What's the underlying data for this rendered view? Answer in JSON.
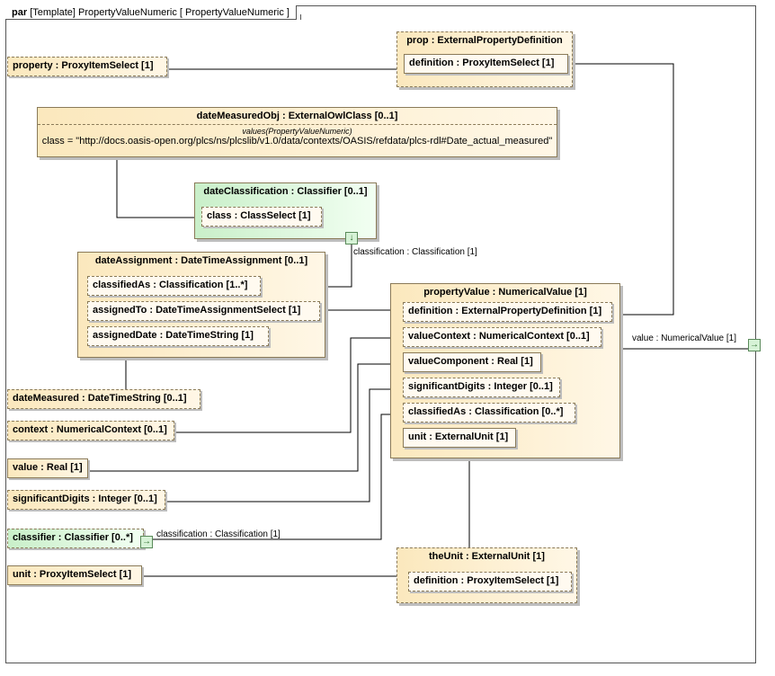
{
  "frame": {
    "kind": "par",
    "label": "[Template] PropertyValueNumeric [ PropertyValueNumeric ]"
  },
  "nodes": {
    "property": "property : ProxyItemSelect [1]",
    "prop_title": "prop : ExternalPropertyDefinition",
    "prop_definition": "definition : ProxyItemSelect [1]",
    "date_measured_obj_title": "dateMeasuredObj : ExternalOwlClass [0..1]",
    "date_measured_obj_values": "values(PropertyValueNumeric)",
    "date_measured_obj_class": "class = \"http://docs.oasis-open.org/plcs/ns/plcslib/v1.0/data/contexts/OASIS/refdata/plcs-rdl#Date_actual_measured\"",
    "date_classification_title": "dateClassification : Classifier [0..1]",
    "date_classification_class": "class : ClassSelect [1]",
    "date_assignment_title": "dateAssignment : DateTimeAssignment [0..1]",
    "date_assignment_classified_as": "classifiedAs : Classification [1..*]",
    "date_assignment_assigned_to": "assignedTo : DateTimeAssignmentSelect [1]",
    "date_assignment_assigned_date": "assignedDate : DateTimeString [1]",
    "date_measured": "dateMeasured : DateTimeString [0..1]",
    "context": "context : NumericalContext [0..1]",
    "value": "value : Real [1]",
    "significant_digits": "significantDigits : Integer [0..1]",
    "classifier": "classifier : Classifier [0..*]",
    "unit": "unit : ProxyItemSelect [1]",
    "property_value_title": "propertyValue : NumericalValue [1]",
    "pv_definition": "definition : ExternalPropertyDefinition [1]",
    "pv_value_context": "valueContext : NumericalContext [0..1]",
    "pv_value_component": "valueComponent : Real [1]",
    "pv_significant_digits": "significantDigits : Integer [0..1]",
    "pv_classified_as": "classifiedAs : Classification [0..*]",
    "pv_unit": "unit : ExternalUnit [1]",
    "the_unit_title": "theUnit : ExternalUnit [1]",
    "the_unit_definition": "definition : ProxyItemSelect [1]"
  },
  "labels": {
    "port_classification_top": "classification : Classification [1]",
    "port_value_out": "value : NumericalValue [1]",
    "port_classification_bottom": "classification : Classification [1]"
  },
  "colors": {
    "class_fill": "#fbe8bd",
    "classifier_fill": "#c9efc9",
    "border": "#8a7a58",
    "wire": "#000000"
  }
}
